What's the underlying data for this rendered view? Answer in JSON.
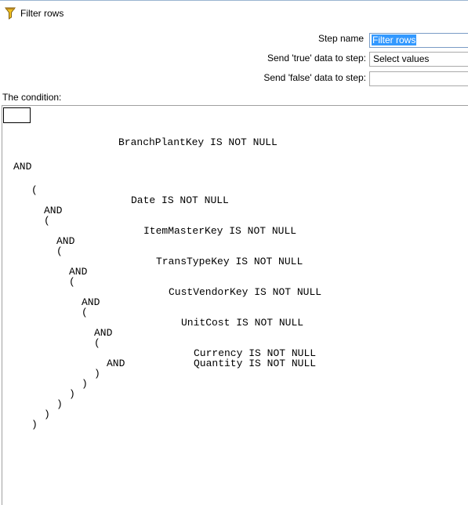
{
  "window": {
    "title": "Filter rows",
    "icon": "filter-funnel-icon"
  },
  "form": {
    "step_name_label": "Step name",
    "step_name_value": "Filter rows",
    "true_label": "Send 'true' data to step:",
    "true_value": "Select values",
    "false_label": "Send 'false' data to step:",
    "false_value": ""
  },
  "condition": {
    "label": "The condition:",
    "fields": {
      "branch": "BranchPlantKey",
      "date": "Date",
      "itemmaster": "ItemMasterKey",
      "transtype": "TransTypeKey",
      "custvendor": "CustVendorKey",
      "unitcost": "UnitCost",
      "currency": "Currency",
      "quantity": "Quantity"
    },
    "function": "IS NOT NULL",
    "operator": "AND",
    "open_paren": "(",
    "close_paren": ")"
  },
  "colors": {
    "selection": "#3399ff",
    "border": "#a9a9a9"
  }
}
